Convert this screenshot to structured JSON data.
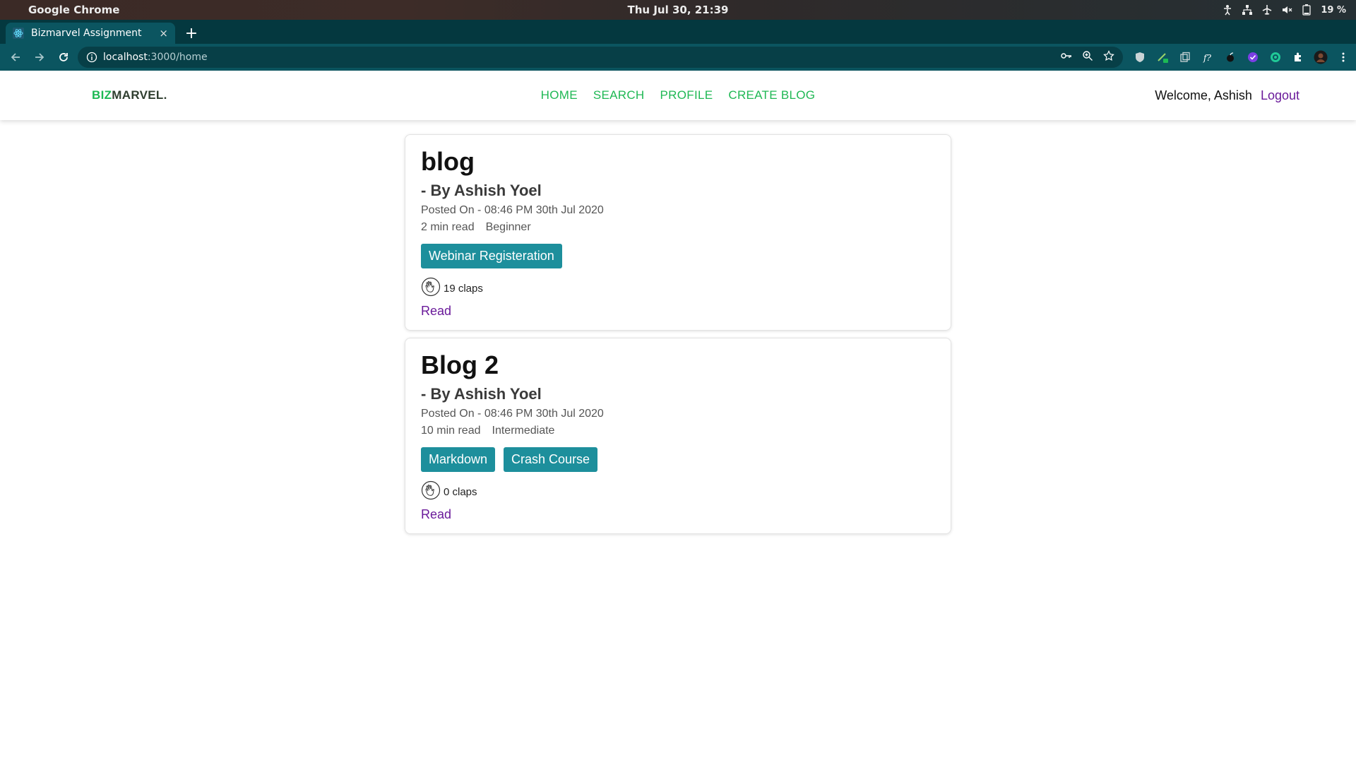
{
  "os": {
    "app_name": "Google Chrome",
    "clock": "Thu Jul 30, 21:39",
    "battery": "19 %"
  },
  "browser": {
    "tab_title": "Bizmarvel Assignment",
    "tab_close": "×",
    "new_tab": "+",
    "url_host": "localhost",
    "url_path": ":3000/home"
  },
  "site": {
    "brand_prefix": "BIZ",
    "brand_suffix": "MARVEL.",
    "nav": [
      "HOME",
      "SEARCH",
      "PROFILE",
      "CREATE BLOG"
    ],
    "welcome": "Welcome, Ashish",
    "logout": "Logout"
  },
  "posts": [
    {
      "title": "blog",
      "author": "- By Ashish Yoel",
      "posted": "Posted On - 08:46 PM 30th Jul 2020",
      "read_time": "2 min read",
      "level": "Beginner",
      "tags": [
        "Webinar Registeration"
      ],
      "claps": "19 claps",
      "read": "Read"
    },
    {
      "title": "Blog 2",
      "author": "- By Ashish Yoel",
      "posted": "Posted On - 08:46 PM 30th Jul 2020",
      "read_time": "10 min read",
      "level": "Intermediate",
      "tags": [
        "Markdown",
        "Crash Course"
      ],
      "claps": "0 claps",
      "read": "Read"
    }
  ],
  "colors": {
    "brand_green": "#1db954",
    "tag_teal": "#1d8f9c",
    "link_purple": "#6a1a9a",
    "chrome_teal": "#0b5560"
  }
}
